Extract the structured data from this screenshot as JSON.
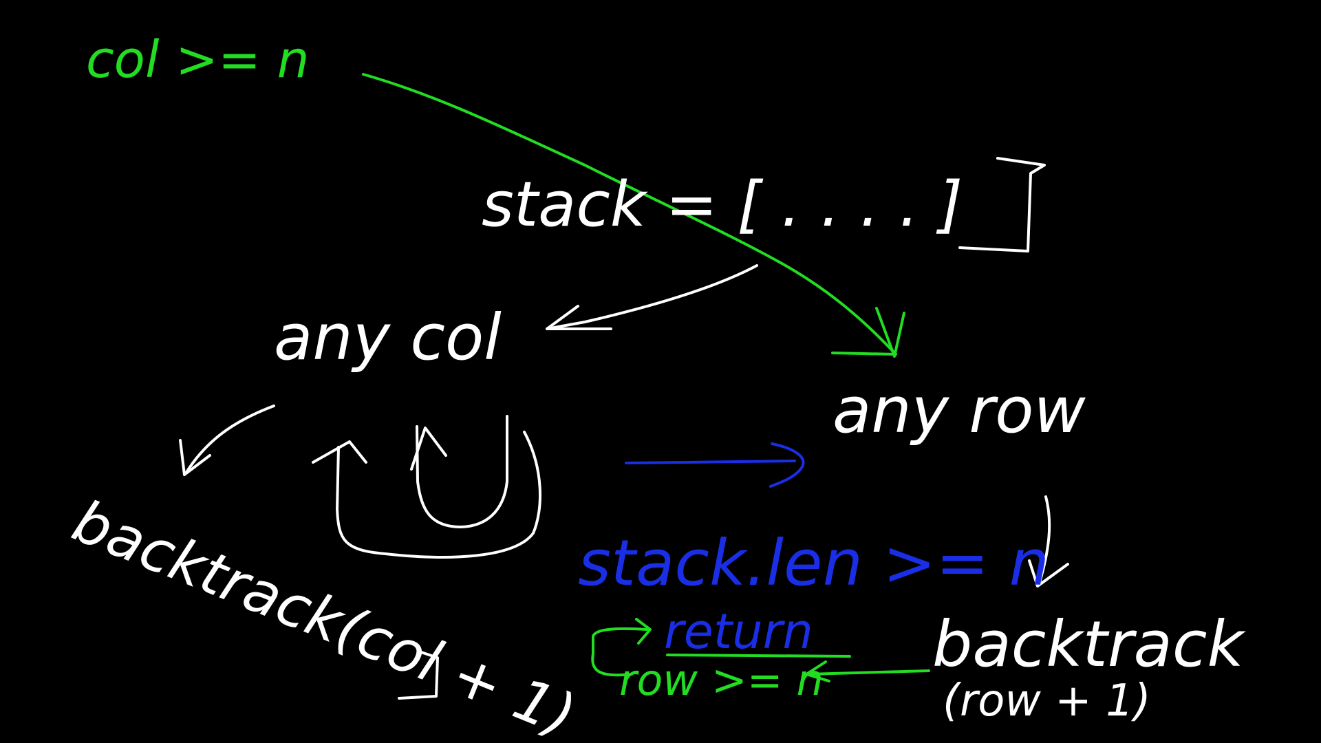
{
  "colors": {
    "background": "#000000",
    "white": "#ffffff",
    "green": "#22dd22",
    "blue": "#1a2ee6"
  },
  "labels": {
    "col_ge_n": "col >= n",
    "stack": "stack = [ . . . . ]",
    "any_col": "any col",
    "any_row": "any row",
    "backtrack_col": "backtrack(col + 1)",
    "backtrack_row": "backtrack",
    "backtrack_row_arg": "(row + 1)",
    "stack_len_ge_n": "stack.len >= n",
    "return": "return",
    "row_ge_n": "row >= n"
  }
}
